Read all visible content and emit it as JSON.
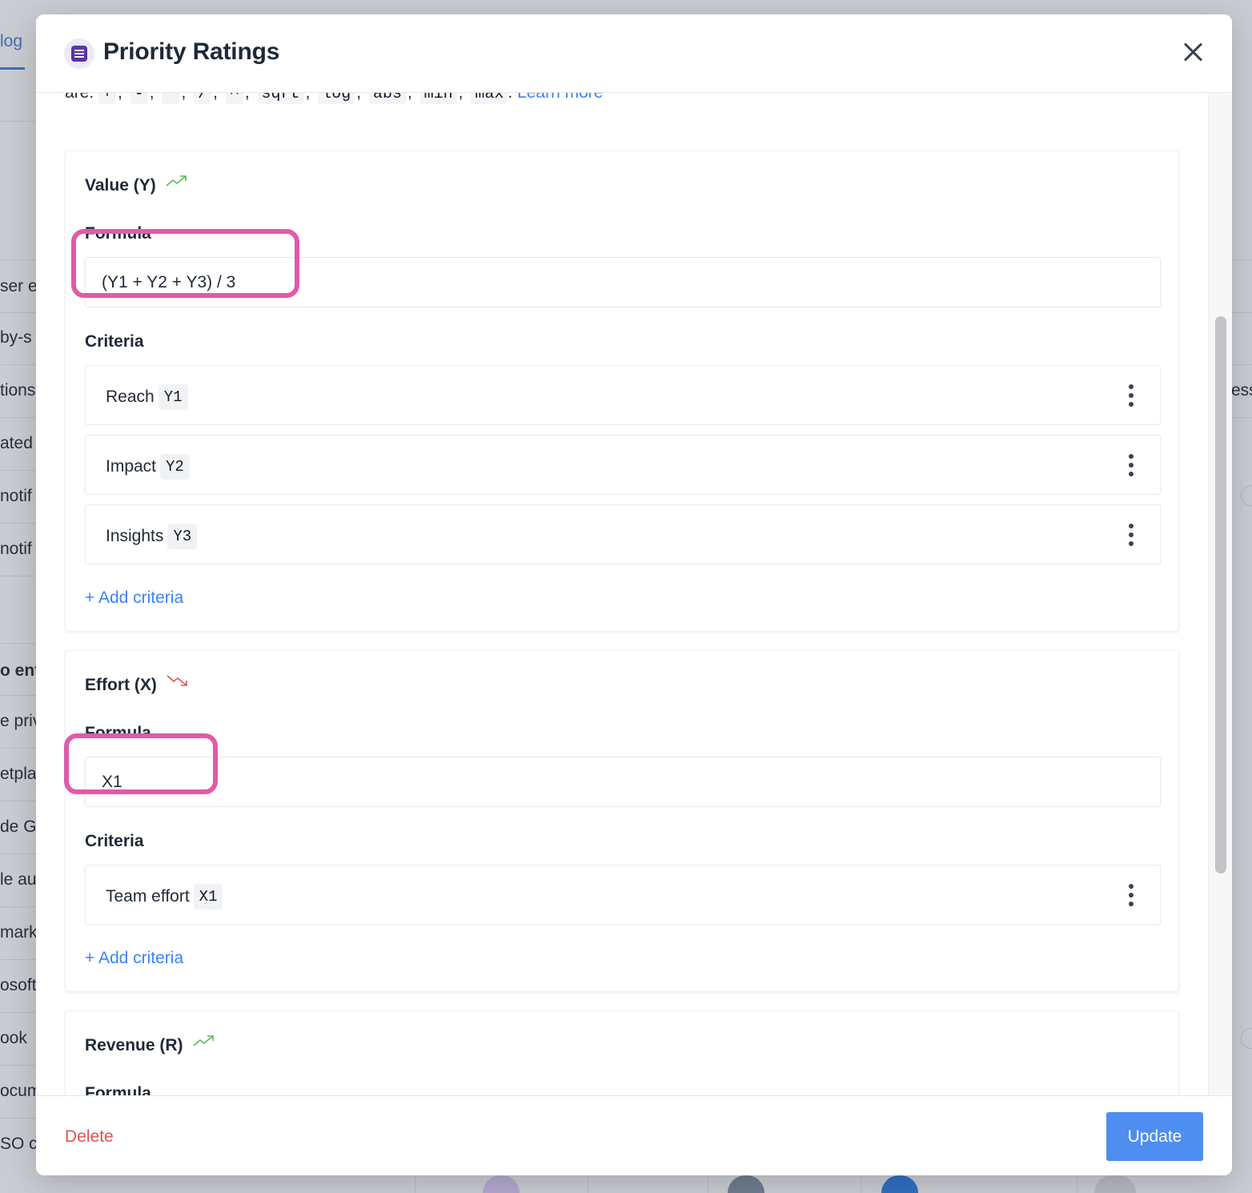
{
  "background": {
    "tab_label": "log",
    "rows": [
      "ser e",
      "by-s",
      "tions",
      "ated",
      "notif",
      "notif",
      "o ent",
      "e priv",
      "etpla",
      "de GI",
      "le au",
      "marke",
      "osoft",
      "ook",
      "ocum",
      "SO ce"
    ],
    "right_fragment": "ess"
  },
  "modal": {
    "title": "Priority Ratings",
    "title_icon": "sliders-icon",
    "close_icon": "close-icon",
    "operators_prefix": "are:",
    "operators": [
      "+",
      "-",
      "*",
      "/",
      "^",
      "sqrt",
      "log",
      "abs",
      "min",
      "max"
    ],
    "operators_suffix": ".",
    "learn_more": "Learn more",
    "sections": [
      {
        "title": "Value (Y)",
        "trend_icon": "trend-up-icon",
        "trend_color": "#5cb85c",
        "formula_label": "Formula",
        "formula_value": "(Y1 + Y2 + Y3) / 3",
        "criteria_label": "Criteria",
        "criteria": [
          {
            "name": "Reach",
            "code": "Y1"
          },
          {
            "name": "Impact",
            "code": "Y2"
          },
          {
            "name": "Insights",
            "code": "Y3"
          }
        ],
        "add_label": "+ Add criteria"
      },
      {
        "title": "Effort (X)",
        "trend_icon": "trend-down-icon",
        "trend_color": "#e05252",
        "formula_label": "Formula",
        "formula_value": "X1",
        "criteria_label": "Criteria",
        "criteria": [
          {
            "name": "Team effort",
            "code": "X1"
          }
        ],
        "add_label": "+ Add criteria"
      },
      {
        "title": "Revenue (R)",
        "trend_icon": "trend-up-icon",
        "trend_color": "#5cb85c",
        "formula_label": "Formula"
      }
    ],
    "footer": {
      "delete_label": "Delete",
      "update_label": "Update"
    },
    "colors": {
      "highlight": "#e05aa8",
      "accent": "#4d8ef0",
      "danger": "#e05252",
      "link": "#3b82f6"
    }
  }
}
